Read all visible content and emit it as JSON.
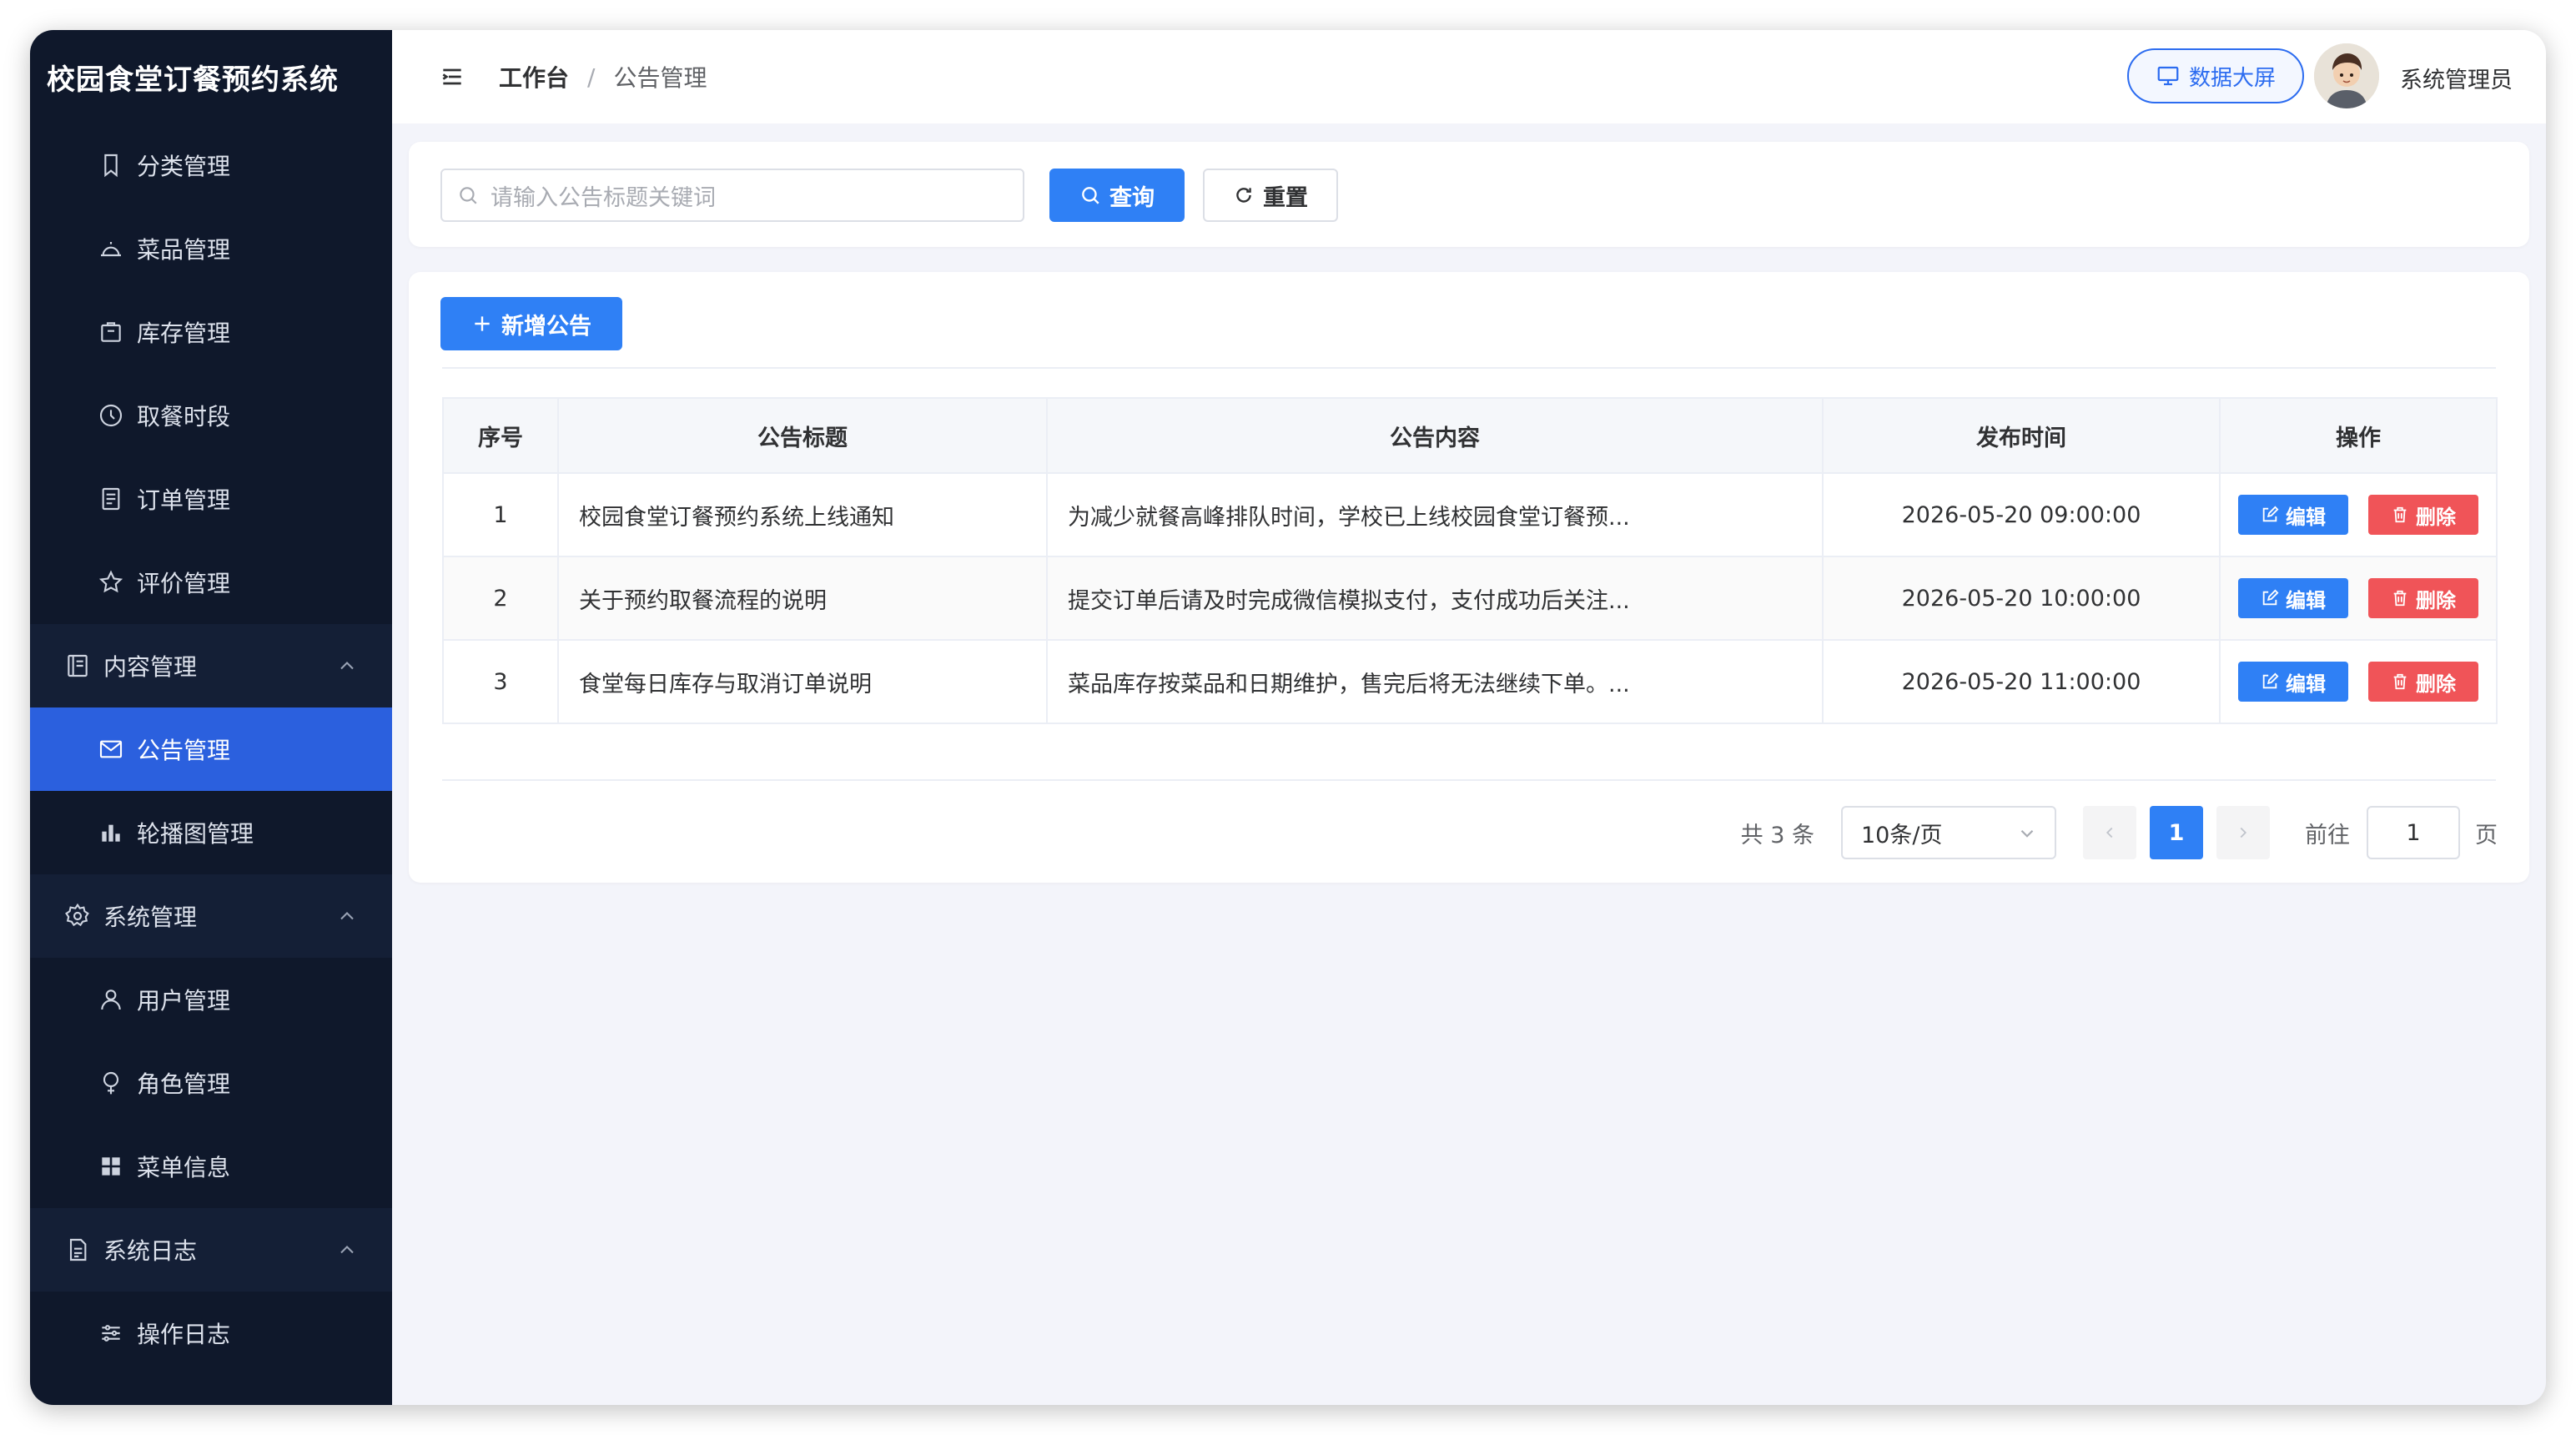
{
  "app": {
    "title": "校园食堂订餐预约系统"
  },
  "sidebar": {
    "items": [
      {
        "label": "分类管理",
        "icon": "bookmark-icon"
      },
      {
        "label": "菜品管理",
        "icon": "dish-icon"
      },
      {
        "label": "库存管理",
        "icon": "box-icon"
      },
      {
        "label": "取餐时段",
        "icon": "clock-icon"
      },
      {
        "label": "订单管理",
        "icon": "document-icon"
      },
      {
        "label": "评价管理",
        "icon": "star-icon"
      }
    ],
    "groups": {
      "content": {
        "label": "内容管理",
        "icon": "notebook-icon",
        "expanded": true
      },
      "system": {
        "label": "系统管理",
        "icon": "gear-icon",
        "expanded": true
      },
      "log": {
        "label": "系统日志",
        "icon": "file-icon",
        "expanded": true
      }
    },
    "content_items": [
      {
        "label": "公告管理",
        "icon": "message-icon",
        "active": true
      },
      {
        "label": "轮播图管理",
        "icon": "bar-chart-icon"
      }
    ],
    "system_items": [
      {
        "label": "用户管理",
        "icon": "user-icon"
      },
      {
        "label": "角色管理",
        "icon": "female-icon"
      },
      {
        "label": "菜单信息",
        "icon": "grid-icon"
      }
    ],
    "log_items": [
      {
        "label": "操作日志",
        "icon": "operation-icon"
      }
    ]
  },
  "header": {
    "breadcrumb": [
      "工作台",
      "公告管理"
    ],
    "separator": "/",
    "bigscreen_label": "数据大屏",
    "username": "系统管理员"
  },
  "search": {
    "placeholder": "请输入公告标题关键词",
    "query_label": "查询",
    "reset_label": "重置"
  },
  "toolbar": {
    "add_label": "新增公告"
  },
  "table": {
    "columns": [
      "序号",
      "公告标题",
      "公告内容",
      "发布时间",
      "操作"
    ],
    "rows": [
      {
        "index": "1",
        "title": "校园食堂订餐预约系统上线通知",
        "content": "为减少就餐高峰排队时间，学校已上线校园食堂订餐预...",
        "time": "2026-05-20 09:00:00"
      },
      {
        "index": "2",
        "title": "关于预约取餐流程的说明",
        "content": "提交订单后请及时完成微信模拟支付，支付成功后关注...",
        "time": "2026-05-20 10:00:00"
      },
      {
        "index": "3",
        "title": "食堂每日库存与取消订单说明",
        "content": "菜品库存按菜品和日期维护，售完后将无法继续下单。...",
        "time": "2026-05-20 11:00:00"
      }
    ],
    "edit_label": "编辑",
    "delete_label": "删除"
  },
  "pagination": {
    "total_text": "共 3 条",
    "page_size": "10条/页",
    "current_page": "1",
    "goto_label": "前往",
    "goto_value": "1",
    "page_unit": "页"
  },
  "colors": {
    "sidebar_bg": "#0f182b",
    "accent": "#2b60de",
    "primary": "#2f80f5",
    "danger": "#f05458"
  }
}
